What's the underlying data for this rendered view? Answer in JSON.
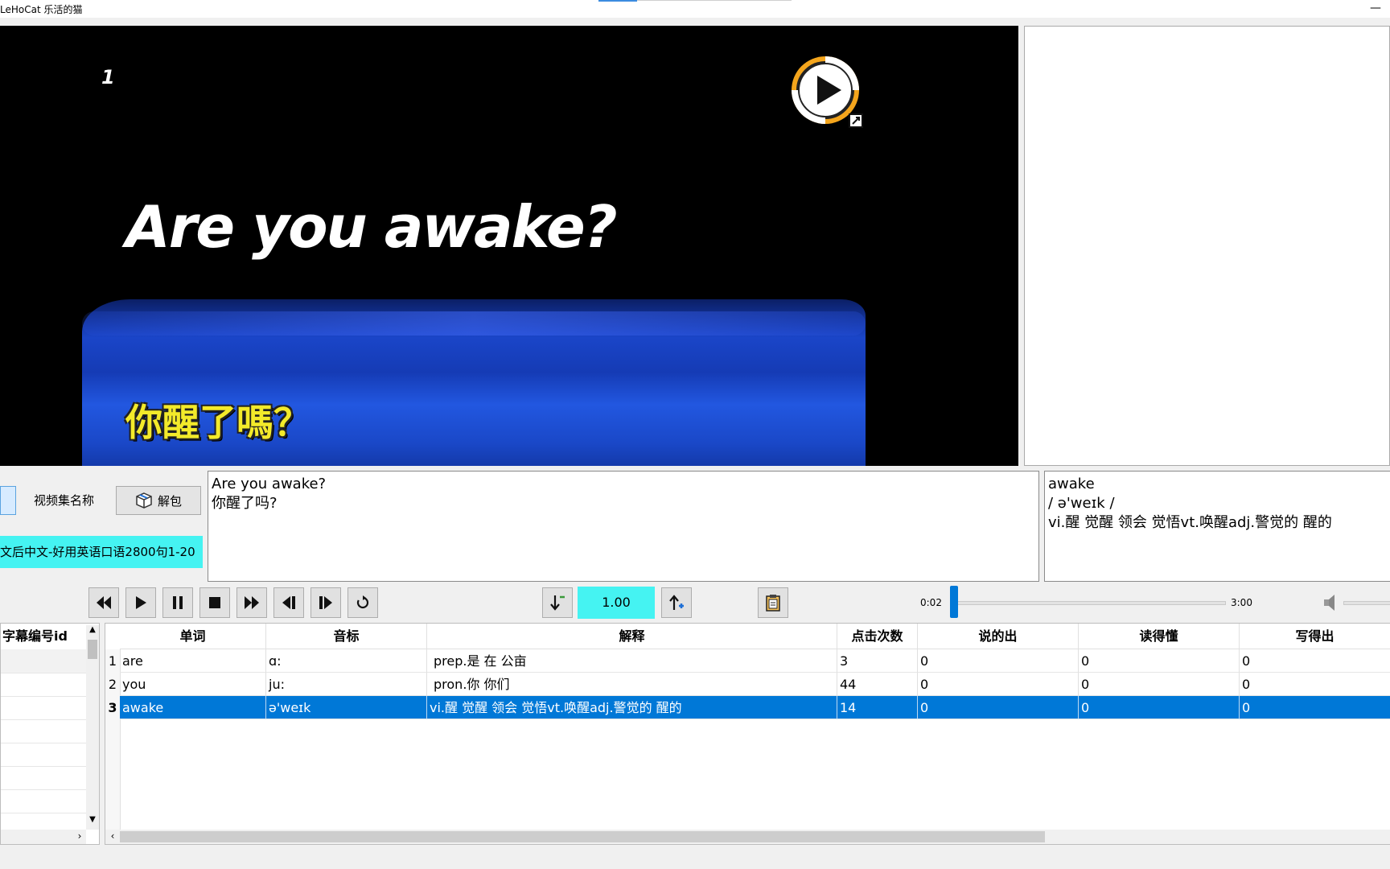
{
  "window": {
    "title": "LeHoCat 乐活的猫",
    "minimize_glyph": "—"
  },
  "video": {
    "clip_number": "1",
    "subtitle_en": "Are you awake?",
    "subtitle_zh": "你醒了嗎？",
    "logo_icon": "play-circle-logo-icon"
  },
  "collection": {
    "label": "视频集名称",
    "unpack_label": "解包",
    "unpack_icon": "box-icon",
    "name": "文后中文-好用英语口语2800句1-20"
  },
  "sentence": {
    "en": "Are you awake?",
    "zh": "你醒了吗?"
  },
  "word_detail": {
    "word": "awake",
    "phonetic": "/ ə'weɪk /",
    "definition": "vi.醒 觉醒 领会 觉悟vt.唤醒adj.警觉的 醒的"
  },
  "playback": {
    "speed": "1.00",
    "time_current": "0:02",
    "time_total": "3:00",
    "progress_fraction": 0.011,
    "buttons": [
      "rewind-icon",
      "play-icon",
      "pause-icon",
      "stop-icon",
      "fast-forward-icon",
      "prev-sentence-icon",
      "next-sentence-icon",
      "repeat-icon"
    ],
    "speed_down_icon": "arrow-down-speed-icon",
    "speed_up_icon": "arrow-up-speed-icon",
    "clipboard_icon": "clipboard-icon",
    "volume_icon": "speaker-icon"
  },
  "left_list": {
    "header": "字幕编号id"
  },
  "word_table": {
    "columns": [
      "单词",
      "音标",
      "解释",
      "点击次数",
      "说的出",
      "读得懂",
      "写得出"
    ],
    "rows": [
      {
        "num": "1",
        "word": "are",
        "phonetic": "ɑ:",
        "definition": "prep.是 在 公亩",
        "clicks": "3",
        "speak": "0",
        "read": "0",
        "write": "0"
      },
      {
        "num": "2",
        "word": "you",
        "phonetic": "ju:",
        "definition": "pron.你 你们",
        "clicks": "44",
        "speak": "0",
        "read": "0",
        "write": "0"
      },
      {
        "num": "3",
        "word": "awake",
        "phonetic": "ə'weɪk",
        "definition": "vi.醒 觉醒 领会 觉悟vt.唤醒adj.警觉的 醒的",
        "clicks": "14",
        "speak": "0",
        "read": "0",
        "write": "0"
      }
    ],
    "selected_row": 2
  },
  "colors": {
    "accent": "#0078d7",
    "cyan_highlight": "#45f3f2",
    "subtitle_yellow": "#f3ea2a"
  }
}
